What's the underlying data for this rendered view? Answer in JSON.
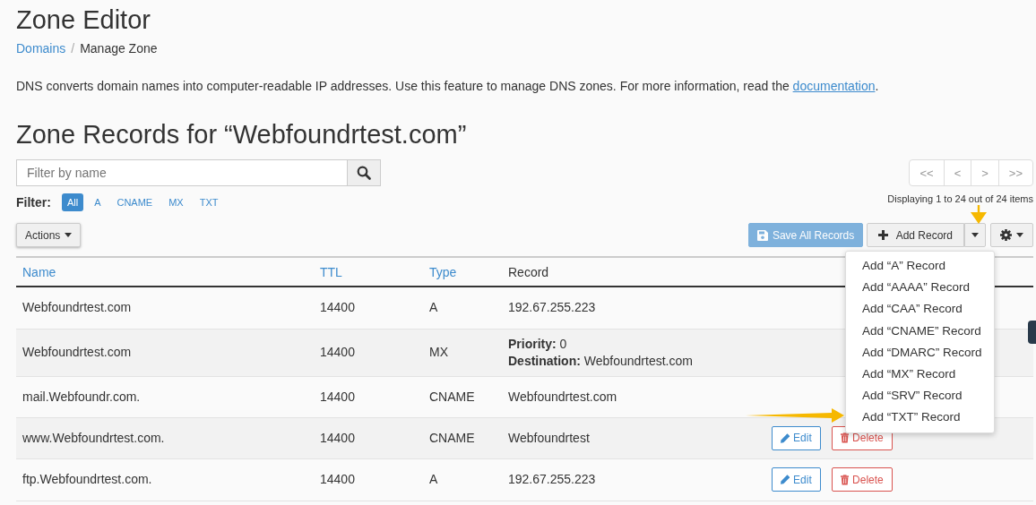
{
  "page": {
    "title": "Zone Editor"
  },
  "breadcrumb": [
    {
      "label": "Domains",
      "link": true
    },
    {
      "label": "Manage Zone",
      "link": false
    }
  ],
  "breadcrumb_separator": "/",
  "description": {
    "text": "DNS converts domain names into computer-readable IP addresses. Use this feature to manage DNS zones. For more information, read the ",
    "link": "documentation",
    "end": "."
  },
  "zone_heading": "Zone Records for “Webfoundrtest.com”",
  "search": {
    "placeholder": "Filter by name"
  },
  "pagination": [
    "<<",
    "<",
    ">",
    ">>"
  ],
  "filter": {
    "label": "Filter:",
    "options": [
      {
        "label": "All",
        "selected": true
      },
      {
        "label": "A",
        "selected": false
      },
      {
        "label": "CNAME",
        "selected": false
      },
      {
        "label": "MX",
        "selected": false
      },
      {
        "label": "TXT",
        "selected": false
      }
    ]
  },
  "display_count": "Displaying 1 to 24 out of 24 items",
  "buttons": {
    "actions": "Actions",
    "save_all": {
      "label": "Save All Records",
      "disabled": true
    },
    "add_record": "Add Record"
  },
  "table": {
    "columns": [
      {
        "label": "Name",
        "sortable": true
      },
      {
        "label": "TTL",
        "sortable": true
      },
      {
        "label": "Type",
        "sortable": true
      },
      {
        "label": "Record",
        "sortable": false
      }
    ],
    "rows": [
      {
        "name": "Webfoundrtest.com",
        "ttl": "14400",
        "type": "A",
        "record": [
          "192.67.255.223"
        ]
      },
      {
        "name": "Webfoundrtest.com",
        "ttl": "14400",
        "type": "MX",
        "record": [
          "**Priority:** 0",
          "**Destination:** Webfoundrtest.com"
        ]
      },
      {
        "name": "mail.Webfoundr.com.",
        "ttl": "14400",
        "type": "CNAME",
        "record": [
          "Webfoundrtest.com"
        ]
      },
      {
        "name": "www.Webfoundrtest.com.",
        "ttl": "14400",
        "type": "CNAME",
        "record": [
          "Webfoundrtest"
        ],
        "actions": [
          {
            "kind": "edit",
            "label": "Edit"
          },
          {
            "kind": "delete",
            "label": "Delete"
          }
        ]
      },
      {
        "name": "ftp.Webfoundrtest.com.",
        "ttl": "14400",
        "type": "A",
        "record": [
          "192.67.255.223"
        ],
        "actions": [
          {
            "kind": "edit",
            "label": "Edit"
          },
          {
            "kind": "delete",
            "label": "Delete"
          }
        ]
      }
    ]
  },
  "add_menu": {
    "items": [
      "Add “A” Record",
      "Add “AAAA” Record",
      "Add “CAA” Record",
      "Add “CNAME” Record",
      "Add “DMARC” Record",
      "Add “MX” Record",
      "Add “SRV” Record",
      "Add “TXT” Record"
    ]
  }
}
